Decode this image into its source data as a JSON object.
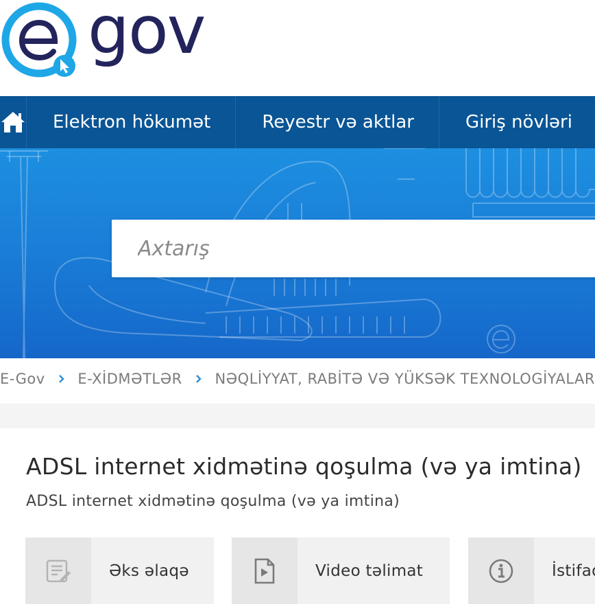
{
  "logo": {
    "letter": "e",
    "word": "gov"
  },
  "nav": {
    "items": [
      {
        "label": "Elektron hökumət"
      },
      {
        "label": "Reyestr və aktlar"
      },
      {
        "label": "Giriş növləri"
      }
    ]
  },
  "search": {
    "placeholder": "Axtarış"
  },
  "breadcrumb": {
    "items": [
      "E-Gov",
      "E-XİDMƏTLƏR",
      "NƏQLİYYAT, RABİTƏ VƏ YÜKSƏK TEXNOLOGİYALAR"
    ]
  },
  "page": {
    "title": "ADSL internet xidmətinə qoşulma (və ya imtina)",
    "subtitle": "ADSL internet xidmətinə qoşulma (və ya imtina)"
  },
  "cards": [
    {
      "label": "Əks əlaqə",
      "icon": "feedback-form-icon"
    },
    {
      "label": "Video təlimat",
      "icon": "video-file-icon"
    },
    {
      "label": "İstifadəçi təlimatı",
      "icon": "info-icon"
    }
  ],
  "colors": {
    "nav_bg": "#0a5596",
    "hero_blue": "#1a7fd8",
    "logo_cyan": "#1ea7e6",
    "logo_text": "#23245c"
  }
}
